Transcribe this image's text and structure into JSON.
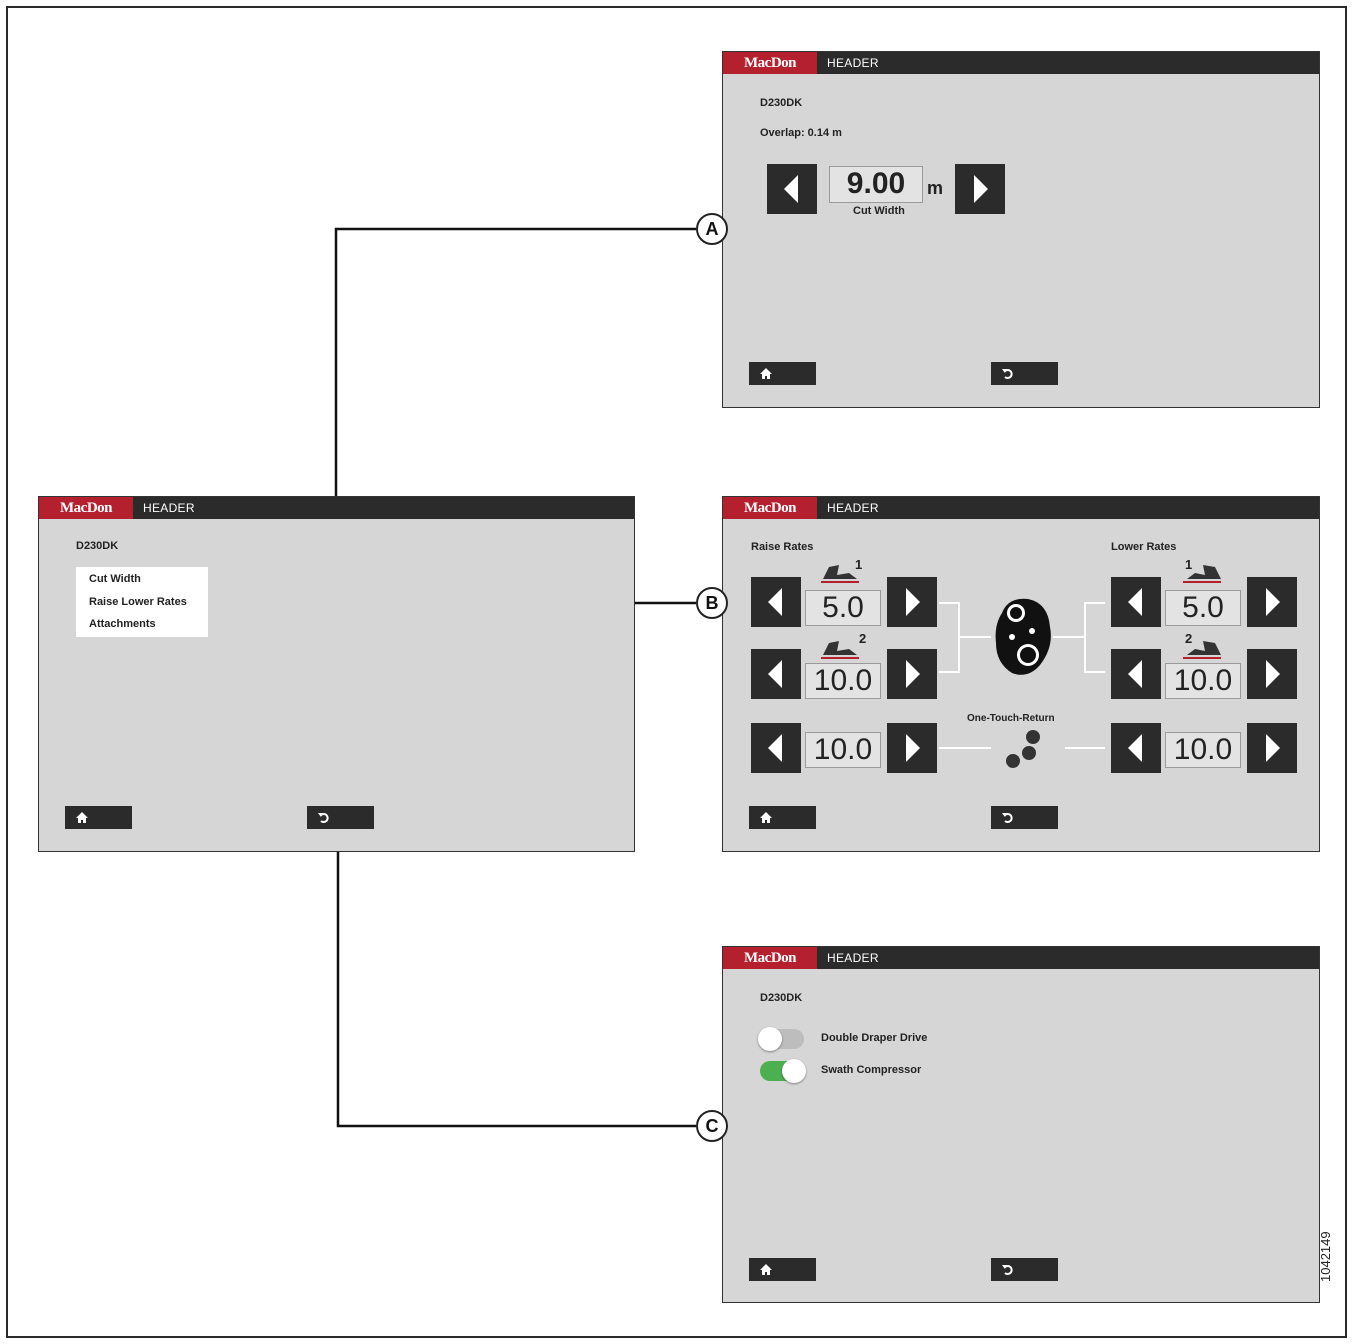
{
  "logo": "MacDon",
  "bar_title": "HEADER",
  "model": "D230DK",
  "main_menu": {
    "items": [
      "Cut Width",
      "Raise Lower Rates",
      "Attachments"
    ]
  },
  "cut_width_screen": {
    "overlap": "Overlap: 0.14 m",
    "value": "9.00",
    "unit": "m",
    "label": "Cut Width"
  },
  "rates_screen": {
    "raise_label": "Raise Rates",
    "lower_label": "Lower Rates",
    "raise_values": [
      "5.0",
      "10.0"
    ],
    "lower_values": [
      "5.0",
      "10.0"
    ],
    "otr_label": "One-Touch-Return",
    "otr_left_value": "10.0",
    "otr_right_value": "10.0",
    "rate_badges": [
      "1",
      "2"
    ]
  },
  "attachments_screen": {
    "options": [
      {
        "label": "Double Draper Drive",
        "on": false
      },
      {
        "label": "Swath Compressor",
        "on": true
      }
    ]
  },
  "callouts": [
    "A",
    "B",
    "C"
  ],
  "figure_id": "1042149",
  "colors": {
    "brand": "#b5202e",
    "toggle_on": "#4caf50",
    "toggle_off": "#bdbdbd"
  }
}
